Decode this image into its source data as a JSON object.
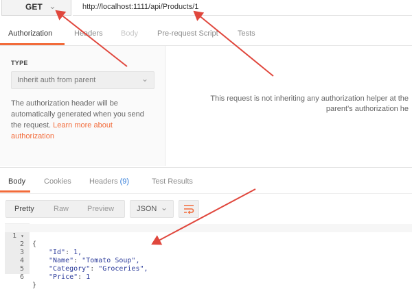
{
  "request": {
    "method": "GET",
    "url": "http://localhost:1111/api/Products/1"
  },
  "request_tabs": [
    {
      "label": "Authorization",
      "state": "active"
    },
    {
      "label": "Headers",
      "state": "normal"
    },
    {
      "label": "Body",
      "state": "disabled"
    },
    {
      "label": "Pre-request Script",
      "state": "normal"
    },
    {
      "label": "Tests",
      "state": "normal"
    }
  ],
  "auth": {
    "type_label": "TYPE",
    "type_value": "Inherit auth from parent",
    "description": "The authorization header will be automatically generated when you send the request.",
    "learn_more_link": "Learn more about authorization",
    "message_line1": "This request is not inheriting any authorization helper at the",
    "message_line2": "parent's authorization he"
  },
  "response_tabs": {
    "body": "Body",
    "cookies": "Cookies",
    "headers": "Headers",
    "headers_count": "(9)",
    "test_results": "Test Results"
  },
  "response_toolbar": {
    "pretty": "Pretty",
    "raw": "Raw",
    "preview": "Preview",
    "format": "JSON"
  },
  "response_body": {
    "lines": [
      {
        "num": "1",
        "text": "{"
      },
      {
        "num": "2",
        "key": "\"Id\"",
        "value": "1,",
        "type": "number"
      },
      {
        "num": "3",
        "key": "\"Name\"",
        "value": "\"Tomato Soup\",",
        "type": "string"
      },
      {
        "num": "4",
        "key": "\"Category\"",
        "value": "\"Groceries\",",
        "type": "string"
      },
      {
        "num": "5",
        "key": "\"Price\"",
        "value": "1",
        "type": "number"
      },
      {
        "num": "6",
        "text": "}"
      }
    ]
  },
  "colors": {
    "accent": "#f26b3a",
    "arrow": "#e0473d",
    "count_blue": "#2f7bd9",
    "json_blue": "#2a3a9a"
  }
}
